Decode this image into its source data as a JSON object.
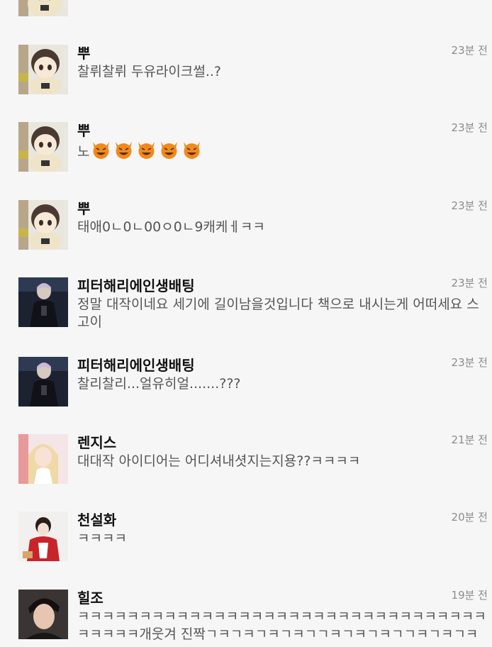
{
  "comments": [
    {
      "username": "",
      "time": "",
      "message": "",
      "avatar": "plush-doll"
    },
    {
      "username": "뿌",
      "time": "23분 전",
      "message": "찰뤼찰뤼 두유라이크썰..?",
      "avatar": "plush-doll"
    },
    {
      "username": "뿌",
      "time": "23분 전",
      "message": "노",
      "emoji": [
        "smiling-devil-emoji",
        "smiling-devil-emoji",
        "smiling-devil-emoji",
        "smiling-devil-emoji",
        "smiling-devil-emoji"
      ],
      "avatar": "plush-doll"
    },
    {
      "username": "뿌",
      "time": "23분 전",
      "message": "태애0ㄴ0ㄴ00ㅇ0ㄴ9캐케ㅔㅋㅋ",
      "avatar": "plush-doll"
    },
    {
      "username": "피터해리에인생배팅",
      "time": "23분 전",
      "message": "정말 대작이네요 세기에 길이남을것입니다 책으로 내시는게 어떠세요 스고이",
      "avatar": "dark-portrait"
    },
    {
      "username": "피터해리에인생배팅",
      "time": "23분 전",
      "message": "찰리찰리...얼유히얼.......???",
      "avatar": "dark-portrait"
    },
    {
      "username": "렌지스",
      "time": "21분 전",
      "message": "대대작 아이디어는 어디셔내셧지는지용??ㅋㅋㅋㅋ",
      "avatar": "blonde-portrait"
    },
    {
      "username": "천설화",
      "time": "20분 전",
      "message": "ㅋㅋㅋㅋ",
      "avatar": "red-outfit-portrait"
    },
    {
      "username": "힐조",
      "time": "19분 전",
      "message": "ㅋㅋㅋㅋㅋㅋㅋㅋㅋㅋㅋㅋㅋㅋㅋㅋㅋㅋㅋㅋㅋㅋㅋㅋㅋㅋㅋㅋㅋㅋㅋㅋㅋㅋㅋㅋㅋㅋ개웃겨 진짝ㄱㅋㄱㅋㄱㅋㄱㅋㄱㄱㅋㄱㅋㄱㅋㄱㄱㅋㄱㅋㄱㅋㄱㅋㄱㅋㄱㅋㄱㅋ",
      "avatar": "boy-portrait"
    }
  ],
  "colors": {
    "background": "#f6f6f6",
    "username": "#111111",
    "message": "#555555",
    "time": "#8c8c8c",
    "devil_emoji": "#f08a1c"
  }
}
